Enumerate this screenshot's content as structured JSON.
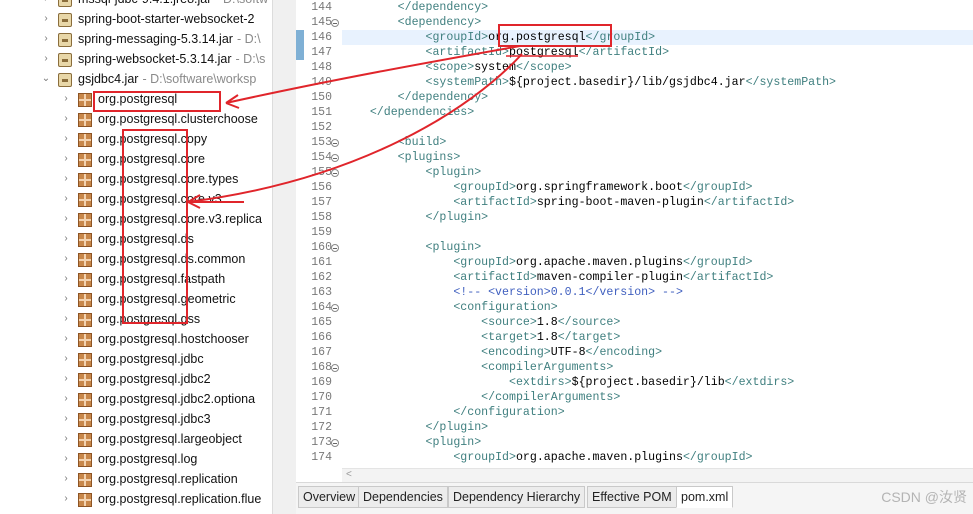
{
  "tree": {
    "items": [
      {
        "kind": "jar",
        "arrow": "›",
        "label": "mssql-jdbc-9.4.1.jre8.jar",
        "path": "- D:\\softw"
      },
      {
        "kind": "jar",
        "arrow": "›",
        "label": "spring-boot-starter-websocket-2",
        "path": ""
      },
      {
        "kind": "jar",
        "arrow": "›",
        "label": "spring-messaging-5.3.14.jar",
        "path": "- D:\\"
      },
      {
        "kind": "jar",
        "arrow": "›",
        "label": "spring-websocket-5.3.14.jar",
        "path": "- D:\\s"
      },
      {
        "kind": "jar",
        "arrow": "⌄",
        "label": "gsjdbc4.jar",
        "path": "- D:\\software\\worksp"
      },
      {
        "kind": "pkg",
        "arrow": "›",
        "label": "org.postgresql",
        "path": ""
      },
      {
        "kind": "pkg",
        "arrow": "›",
        "label": "org.postgresql.clusterchoose",
        "path": ""
      },
      {
        "kind": "pkg",
        "arrow": "›",
        "label": "org.postgresql.copy",
        "path": ""
      },
      {
        "kind": "pkg",
        "arrow": "›",
        "label": "org.postgresql.core",
        "path": ""
      },
      {
        "kind": "pkg",
        "arrow": "›",
        "label": "org.postgresql.core.types",
        "path": ""
      },
      {
        "kind": "pkg",
        "arrow": "›",
        "label": "org.postgresql.core.v3",
        "path": ""
      },
      {
        "kind": "pkg",
        "arrow": "›",
        "label": "org.postgresql.core.v3.replica",
        "path": ""
      },
      {
        "kind": "pkg",
        "arrow": "›",
        "label": "org.postgresql.ds",
        "path": ""
      },
      {
        "kind": "pkg",
        "arrow": "›",
        "label": "org.postgresql.ds.common",
        "path": ""
      },
      {
        "kind": "pkg",
        "arrow": "›",
        "label": "org.postgresql.fastpath",
        "path": ""
      },
      {
        "kind": "pkg",
        "arrow": "›",
        "label": "org.postgresql.geometric",
        "path": ""
      },
      {
        "kind": "pkg",
        "arrow": "›",
        "label": "org.postgresql.gss",
        "path": ""
      },
      {
        "kind": "pkg",
        "arrow": "›",
        "label": "org.postgresql.hostchooser",
        "path": ""
      },
      {
        "kind": "pkg",
        "arrow": "›",
        "label": "org.postgresql.jdbc",
        "path": ""
      },
      {
        "kind": "pkg",
        "arrow": "›",
        "label": "org.postgresql.jdbc2",
        "path": ""
      },
      {
        "kind": "pkg",
        "arrow": "›",
        "label": "org.postgresql.jdbc2.optiona",
        "path": ""
      },
      {
        "kind": "pkg",
        "arrow": "›",
        "label": "org.postgresql.jdbc3",
        "path": ""
      },
      {
        "kind": "pkg",
        "arrow": "›",
        "label": "org.postgresql.largeobject",
        "path": ""
      },
      {
        "kind": "pkg",
        "arrow": "›",
        "label": "org.postgresql.log",
        "path": ""
      },
      {
        "kind": "pkg",
        "arrow": "›",
        "label": "org.postgresql.replication",
        "path": ""
      },
      {
        "kind": "pkg",
        "arrow": "›",
        "label": "org.postgresql.replication.flue",
        "path": ""
      }
    ]
  },
  "editor": {
    "lines": [
      {
        "n": "144",
        "text": "        </dependency>",
        "fold": false
      },
      {
        "n": "145",
        "text": "        <dependency>",
        "fold": true
      },
      {
        "n": "146",
        "text": "            <groupId>org.postgresql</groupId>",
        "fold": false,
        "current": true,
        "changed": true
      },
      {
        "n": "147",
        "text": "            <artifactId>postgresql</artifactId>",
        "fold": false,
        "changed": true
      },
      {
        "n": "148",
        "text": "            <scope>system</scope>",
        "fold": false
      },
      {
        "n": "149",
        "text": "            <systemPath>${project.basedir}/lib/gsjdbc4.jar</systemPath>",
        "fold": false
      },
      {
        "n": "150",
        "text": "        </dependency>",
        "fold": false
      },
      {
        "n": "151",
        "text": "    </dependencies>",
        "fold": false
      },
      {
        "n": "152",
        "text": "",
        "fold": false
      },
      {
        "n": "153",
        "text": "        <build>",
        "fold": true
      },
      {
        "n": "154",
        "text": "        <plugins>",
        "fold": true
      },
      {
        "n": "155",
        "text": "            <plugin>",
        "fold": true
      },
      {
        "n": "156",
        "text": "                <groupId>org.springframework.boot</groupId>",
        "fold": false
      },
      {
        "n": "157",
        "text": "                <artifactId>spring-boot-maven-plugin</artifactId>",
        "fold": false
      },
      {
        "n": "158",
        "text": "            </plugin>",
        "fold": false
      },
      {
        "n": "159",
        "text": "",
        "fold": false
      },
      {
        "n": "160",
        "text": "            <plugin>",
        "fold": true
      },
      {
        "n": "161",
        "text": "                <groupId>org.apache.maven.plugins</groupId>",
        "fold": false
      },
      {
        "n": "162",
        "text": "                <artifactId>maven-compiler-plugin</artifactId>",
        "fold": false
      },
      {
        "n": "163",
        "text": "                <!-- <version>0.0.1</version> -->",
        "fold": false,
        "comment": true
      },
      {
        "n": "164",
        "text": "                <configuration>",
        "fold": true
      },
      {
        "n": "165",
        "text": "                    <source>1.8</source>",
        "fold": false
      },
      {
        "n": "166",
        "text": "                    <target>1.8</target>",
        "fold": false
      },
      {
        "n": "167",
        "text": "                    <encoding>UTF-8</encoding>",
        "fold": false
      },
      {
        "n": "168",
        "text": "                    <compilerArguments>",
        "fold": true
      },
      {
        "n": "169",
        "text": "                        <extdirs>${project.basedir}/lib</extdirs>",
        "fold": false
      },
      {
        "n": "170",
        "text": "                    </compilerArguments>",
        "fold": false
      },
      {
        "n": "171",
        "text": "                </configuration>",
        "fold": false
      },
      {
        "n": "172",
        "text": "            </plugin>",
        "fold": false
      },
      {
        "n": "173",
        "text": "            <plugin>",
        "fold": true
      },
      {
        "n": "174",
        "text": "                <groupId>org.apache.maven.plugins</groupId>",
        "fold": false
      }
    ]
  },
  "tabs": [
    "Overview",
    "Dependencies",
    "Dependency Hierarchy",
    "Effective POM",
    "pom.xml"
  ],
  "active_tab": "pom.xml",
  "watermark": "CSDN @汝贤",
  "colors": {
    "annotation": "#e0252b",
    "tag": "#3f7f7f",
    "comment": "#3f5fbf",
    "current_line": "#e8f2fe"
  }
}
